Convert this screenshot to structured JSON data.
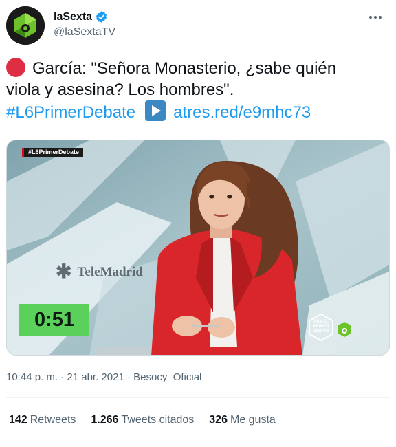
{
  "author": {
    "display_name": "laSexta",
    "handle": "@laSextaTV",
    "verified_icon": "verified-badge-icon",
    "avatar_icon": "lasexta-logo-icon"
  },
  "more_icon": "more-options-icon",
  "tweet": {
    "line1": "García: \"Señora Monasterio, ¿sabe quién",
    "line2": "viola y asesina? Los hombres\".",
    "hashtag": "#L6PrimerDebate",
    "link": "atres.red/e9mhc73",
    "red_circle_icon": "red-circle-emoji-icon",
    "play_icon": "play-button-emoji-icon"
  },
  "media": {
    "overlay_hashtag": "#L6PrimerDebate",
    "broadcaster": "TeleMadrid",
    "timer": "0:51",
    "badge_text": "ARV EL PRIMER DEBATE"
  },
  "meta": {
    "time": "10:44 p. m.",
    "separator": "·",
    "date": "21 abr. 2021",
    "source": "Besocy_Oficial"
  },
  "stats": {
    "retweets_count": "142",
    "retweets_label": "Retweets",
    "quotes_count": "1.266",
    "quotes_label": "Tweets citados",
    "likes_count": "326",
    "likes_label": "Me gusta"
  },
  "colors": {
    "link": "#1d9bf0",
    "secondary_text": "#536471",
    "lasexta_green": "#6dc12b",
    "timer_green": "#5bd15c",
    "jacket_red": "#d8262b"
  }
}
